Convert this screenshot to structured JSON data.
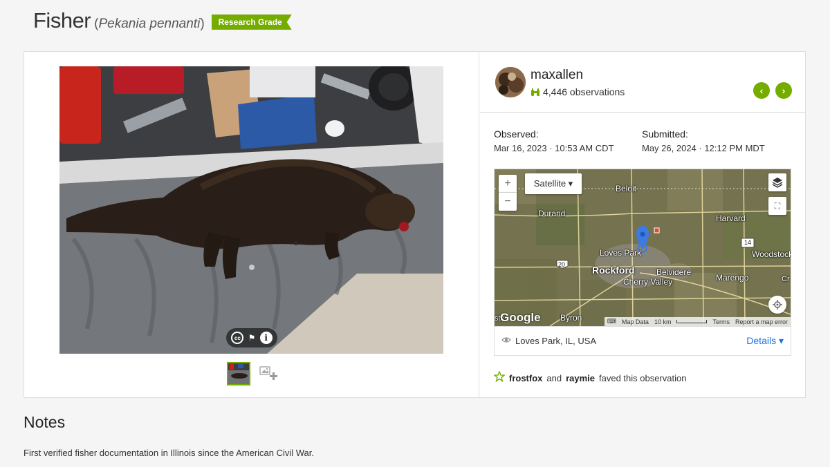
{
  "header": {
    "common_name": "Fisher",
    "scientific_name": "Pekania pennanti",
    "quality_grade": "Research Grade"
  },
  "photo": {
    "photo_controls": {
      "cc_glyph": "cc",
      "flag_glyph": "⚑",
      "info_glyph": "i"
    }
  },
  "observer": {
    "username": "maxallen",
    "observation_count": "4,446 observations",
    "prev_glyph": "‹",
    "next_glyph": "›"
  },
  "dates": {
    "observed_label": "Observed:",
    "observed_value": "Mar 16, 2023 · 10:53 AM CDT",
    "submitted_label": "Submitted:",
    "submitted_value": "May 26, 2024 · 12:12 PM MDT"
  },
  "map": {
    "zoom_in": "+",
    "zoom_out": "−",
    "basemap_select": "Satellite ▾",
    "fullscreen_glyph": "⛶",
    "google_logo": "Google",
    "footer": {
      "map_data": "Map Data",
      "scale": "10 km",
      "terms": "Terms",
      "report": "Report a map error"
    },
    "place_labels": {
      "beloit": "Beloit",
      "durand": "Durand",
      "harvard": "Harvard",
      "loves_park": "Loves Park",
      "rockford": "Rockford",
      "belvidere": "Belvidere",
      "cherry_valley": "Cherry Valley",
      "marengo": "Marengo",
      "woodstock": "Woodstock",
      "byron": "Byron",
      "stc": "stc",
      "cr": "Cr"
    },
    "highway_shields": {
      "us20": "20",
      "il14": "14"
    }
  },
  "location": {
    "place": "Loves Park, IL, USA",
    "details_label": "Details ▾"
  },
  "faves": {
    "user1": "frostfox",
    "connector": "and",
    "user2": "raymie",
    "suffix": "faved this observation"
  },
  "notes": {
    "heading": "Notes",
    "text": "First verified fisher documentation in Illinois since the American Civil War."
  },
  "colors": {
    "accent_green": "#74ac00",
    "link_blue": "#1a73e8"
  },
  "icons": {
    "binoculars": "binoculars-icon",
    "star": "star-outline-icon",
    "eye": "eye-icon",
    "layers": "layers-icon",
    "locate": "locate-icon",
    "add_photo": "add-photo-icon"
  }
}
